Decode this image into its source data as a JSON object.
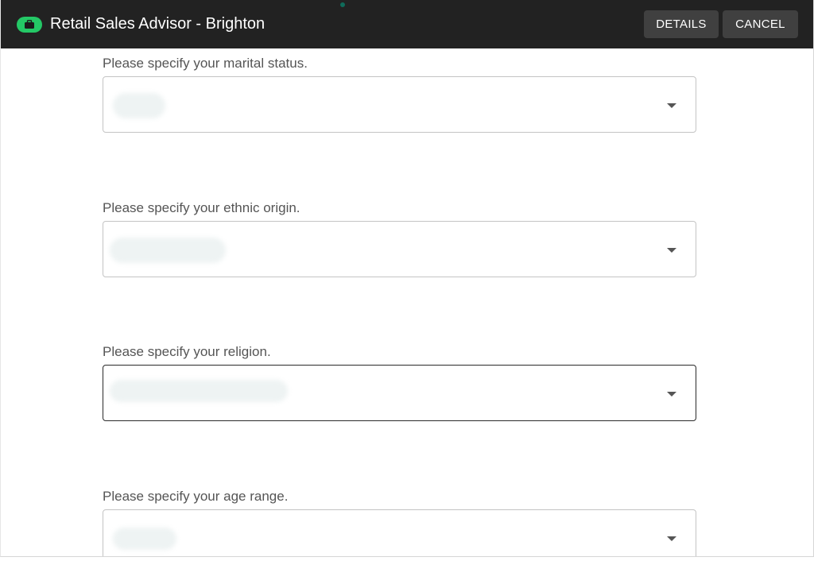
{
  "header": {
    "title": "Retail Sales Advisor - Brighton",
    "brand_icon": "briefcase-icon",
    "accent_color": "#24c866",
    "buttons": {
      "details_label": "DETAILS",
      "cancel_label": "CANCEL"
    }
  },
  "form": {
    "questions": [
      {
        "label": "Please specify your marital status.",
        "value": ""
      },
      {
        "label": "Please specify your ethnic origin.",
        "value": ""
      },
      {
        "label": "Please specify your religion.",
        "value": ""
      },
      {
        "label": "Please specify your age range.",
        "value": ""
      }
    ],
    "dropdown_icon": "caret-down-icon"
  }
}
